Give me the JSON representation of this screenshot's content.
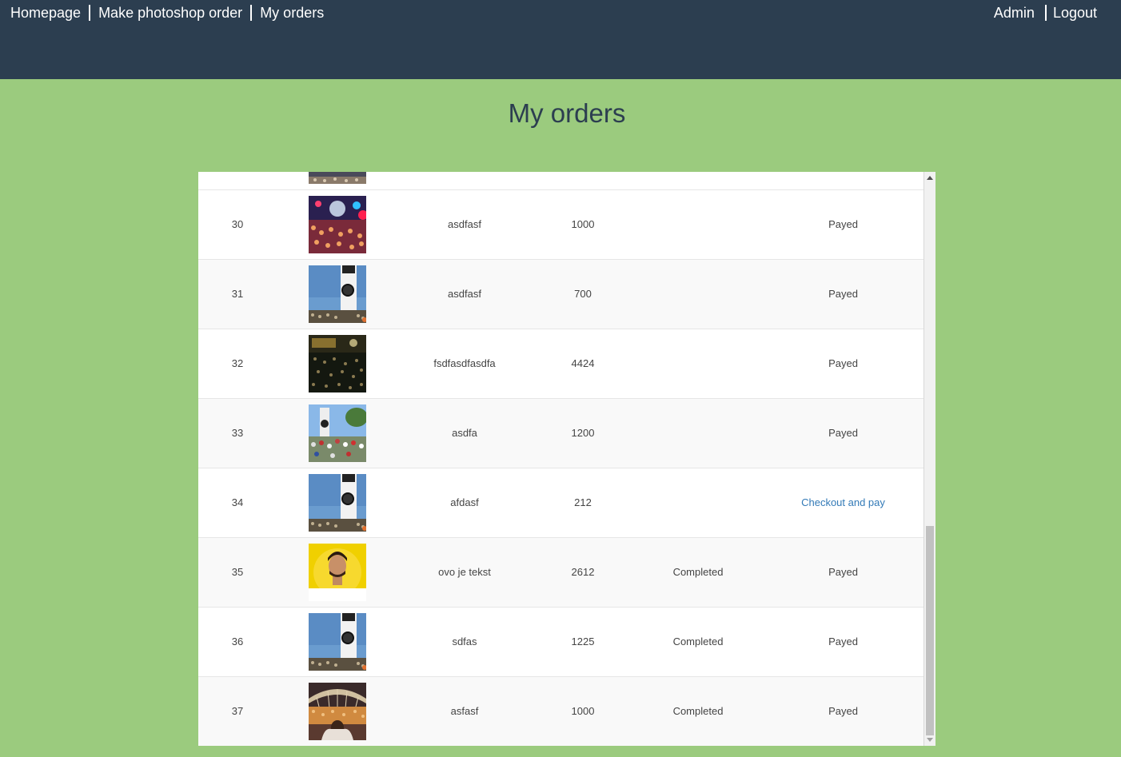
{
  "nav": {
    "left": [
      "Homepage",
      "Make photoshop order",
      "My orders"
    ],
    "right": [
      "Admin",
      "Logout"
    ]
  },
  "page_title": "My orders",
  "orders": [
    {
      "id": "30",
      "image": "concert-crowd-lights",
      "description": "asdfasf",
      "price": "1000",
      "status": "",
      "payment": "Payed"
    },
    {
      "id": "31",
      "image": "clock-tower",
      "description": "asdfasf",
      "price": "700",
      "status": "",
      "payment": "Payed"
    },
    {
      "id": "32",
      "image": "night-festival-crowd",
      "description": "fsdfasdfasdfa",
      "price": "4424",
      "status": "",
      "payment": "Payed"
    },
    {
      "id": "33",
      "image": "clock-tower-crowd",
      "description": "asdfa",
      "price": "1200",
      "status": "",
      "payment": "Payed"
    },
    {
      "id": "34",
      "image": "clock-tower",
      "description": "afdasf",
      "price": "212",
      "status": "",
      "payment": "Checkout and pay"
    },
    {
      "id": "35",
      "image": "portrait-man",
      "description": "ovo je tekst",
      "price": "2612",
      "status": "Completed",
      "payment": "Payed"
    },
    {
      "id": "36",
      "image": "clock-tower",
      "description": "sdfas",
      "price": "1225",
      "status": "Completed",
      "payment": "Payed"
    },
    {
      "id": "37",
      "image": "stadium-crowd",
      "description": "asfasf",
      "price": "1000",
      "status": "Completed",
      "payment": "Payed"
    }
  ],
  "colors": {
    "header_bg": "#2c3e50",
    "page_bg": "#9bcb7e",
    "link": "#337ab7"
  }
}
